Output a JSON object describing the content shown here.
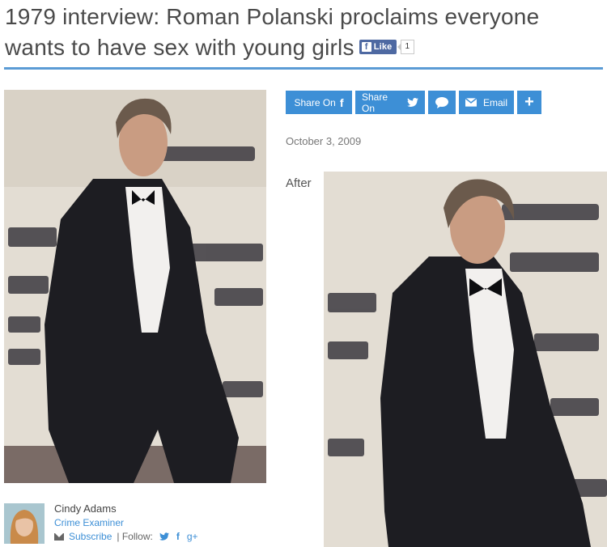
{
  "article": {
    "headline": "1979 interview: Roman Polanski proclaims everyone wants to have sex with young girls",
    "like": {
      "label": "Like",
      "count": "1"
    },
    "date": "October 3, 2009",
    "after_caption": "After"
  },
  "share": {
    "facebook_label": "Share On",
    "facebook_icon": "f",
    "twitter_label": "Share On",
    "twitter_icon": "twitter-bird-icon",
    "comment_icon": "speech-bubble-icon",
    "email_label": "Email",
    "email_icon": "envelope-icon",
    "more_icon": "+"
  },
  "author": {
    "name": "Cindy Adams",
    "role": "Crime Examiner",
    "subscribe_label": "Subscribe",
    "follow_label": "| Follow:",
    "twitter_icon": "twitter-bird-icon",
    "facebook_icon": "f",
    "gplus_icon": "g+"
  },
  "colors": {
    "accent": "#3d8fd6",
    "rule": "#5b9bd5",
    "facebook": "#4e69a2"
  }
}
